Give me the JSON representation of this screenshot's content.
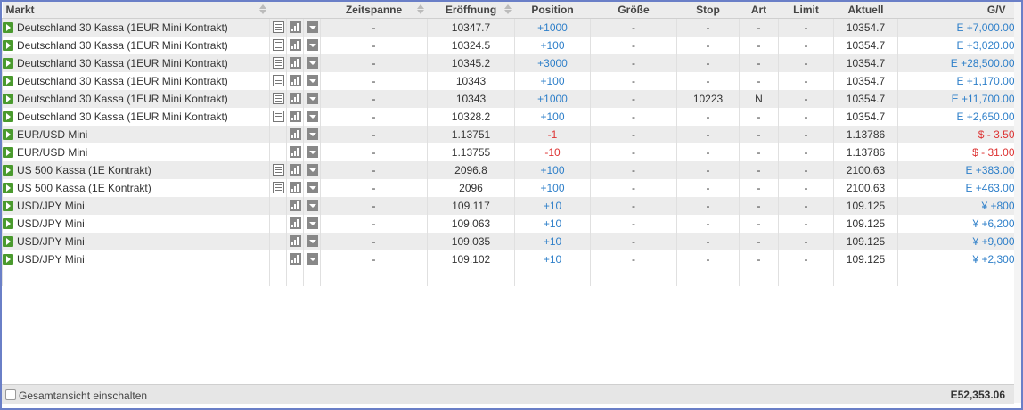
{
  "columns": {
    "markt": "Markt",
    "zeitspanne": "Zeitspanne",
    "eroeffnung": "Eröffnung",
    "position": "Position",
    "groesse": "Größe",
    "stop": "Stop",
    "art": "Art",
    "limit": "Limit",
    "aktuell": "Aktuell",
    "gv": "G/V"
  },
  "colors": {
    "positive": "#2e7fc9",
    "negative": "#dd3333",
    "play": "#4a9a2e"
  },
  "rows": [
    {
      "market": "Deutschland 30 Kassa (1EUR Mini Kontrakt)",
      "has_doc": true,
      "zeitspanne": "-",
      "eroeffnung": "10347.7",
      "position": "+1000",
      "pos_sign": "pos",
      "groesse": "-",
      "stop": "-",
      "art": "-",
      "limit": "-",
      "aktuell": "10354.7",
      "gv": "E +7,000.00",
      "gv_sign": "pos"
    },
    {
      "market": "Deutschland 30 Kassa (1EUR Mini Kontrakt)",
      "has_doc": true,
      "zeitspanne": "-",
      "eroeffnung": "10324.5",
      "position": "+100",
      "pos_sign": "pos",
      "groesse": "-",
      "stop": "-",
      "art": "-",
      "limit": "-",
      "aktuell": "10354.7",
      "gv": "E +3,020.00",
      "gv_sign": "pos"
    },
    {
      "market": "Deutschland 30 Kassa (1EUR Mini Kontrakt)",
      "has_doc": true,
      "zeitspanne": "-",
      "eroeffnung": "10345.2",
      "position": "+3000",
      "pos_sign": "pos",
      "groesse": "-",
      "stop": "-",
      "art": "-",
      "limit": "-",
      "aktuell": "10354.7",
      "gv": "E +28,500.00",
      "gv_sign": "pos"
    },
    {
      "market": "Deutschland 30 Kassa (1EUR Mini Kontrakt)",
      "has_doc": true,
      "zeitspanne": "-",
      "eroeffnung": "10343",
      "position": "+100",
      "pos_sign": "pos",
      "groesse": "-",
      "stop": "-",
      "art": "-",
      "limit": "-",
      "aktuell": "10354.7",
      "gv": "E +1,170.00",
      "gv_sign": "pos"
    },
    {
      "market": "Deutschland 30 Kassa (1EUR Mini Kontrakt)",
      "has_doc": true,
      "zeitspanne": "-",
      "eroeffnung": "10343",
      "position": "+1000",
      "pos_sign": "pos",
      "groesse": "-",
      "stop": "10223",
      "art": "N",
      "limit": "-",
      "aktuell": "10354.7",
      "gv": "E +11,700.00",
      "gv_sign": "pos"
    },
    {
      "market": "Deutschland 30 Kassa (1EUR Mini Kontrakt)",
      "has_doc": true,
      "zeitspanne": "-",
      "eroeffnung": "10328.2",
      "position": "+100",
      "pos_sign": "pos",
      "groesse": "-",
      "stop": "-",
      "art": "-",
      "limit": "-",
      "aktuell": "10354.7",
      "gv": "E +2,650.00",
      "gv_sign": "pos"
    },
    {
      "market": "EUR/USD Mini",
      "has_doc": false,
      "zeitspanne": "-",
      "eroeffnung": "1.13751",
      "position": "-1",
      "pos_sign": "neg",
      "groesse": "-",
      "stop": "-",
      "art": "-",
      "limit": "-",
      "aktuell": "1.13786",
      "gv": "$ - 3.50",
      "gv_sign": "neg"
    },
    {
      "market": "EUR/USD Mini",
      "has_doc": false,
      "zeitspanne": "-",
      "eroeffnung": "1.13755",
      "position": "-10",
      "pos_sign": "neg",
      "groesse": "-",
      "stop": "-",
      "art": "-",
      "limit": "-",
      "aktuell": "1.13786",
      "gv": "$ - 31.00",
      "gv_sign": "neg"
    },
    {
      "market": "US 500 Kassa (1E Kontrakt)",
      "has_doc": true,
      "zeitspanne": "-",
      "eroeffnung": "2096.8",
      "position": "+100",
      "pos_sign": "pos",
      "groesse": "-",
      "stop": "-",
      "art": "-",
      "limit": "-",
      "aktuell": "2100.63",
      "gv": "E +383.00",
      "gv_sign": "pos"
    },
    {
      "market": "US 500 Kassa (1E Kontrakt)",
      "has_doc": true,
      "zeitspanne": "-",
      "eroeffnung": "2096",
      "position": "+100",
      "pos_sign": "pos",
      "groesse": "-",
      "stop": "-",
      "art": "-",
      "limit": "-",
      "aktuell": "2100.63",
      "gv": "E +463.00",
      "gv_sign": "pos"
    },
    {
      "market": "USD/JPY Mini",
      "has_doc": false,
      "zeitspanne": "-",
      "eroeffnung": "109.117",
      "position": "+10",
      "pos_sign": "pos",
      "groesse": "-",
      "stop": "-",
      "art": "-",
      "limit": "-",
      "aktuell": "109.125",
      "gv": "¥ +800",
      "gv_sign": "pos"
    },
    {
      "market": "USD/JPY Mini",
      "has_doc": false,
      "zeitspanne": "-",
      "eroeffnung": "109.063",
      "position": "+10",
      "pos_sign": "pos",
      "groesse": "-",
      "stop": "-",
      "art": "-",
      "limit": "-",
      "aktuell": "109.125",
      "gv": "¥ +6,200",
      "gv_sign": "pos"
    },
    {
      "market": "USD/JPY Mini",
      "has_doc": false,
      "zeitspanne": "-",
      "eroeffnung": "109.035",
      "position": "+10",
      "pos_sign": "pos",
      "groesse": "-",
      "stop": "-",
      "art": "-",
      "limit": "-",
      "aktuell": "109.125",
      "gv": "¥ +9,000",
      "gv_sign": "pos"
    },
    {
      "market": "USD/JPY Mini",
      "has_doc": false,
      "zeitspanne": "-",
      "eroeffnung": "109.102",
      "position": "+10",
      "pos_sign": "pos",
      "groesse": "-",
      "stop": "-",
      "art": "-",
      "limit": "-",
      "aktuell": "109.125",
      "gv": "¥ +2,300",
      "gv_sign": "pos"
    }
  ],
  "footer": {
    "toggle_label": "Gesamtansicht einschalten",
    "total": "E52,353.06"
  },
  "icons": {
    "row_expand": "play-icon",
    "details": "document-icon",
    "chart": "bar-chart-icon",
    "menu": "dropdown-icon",
    "sort": "sort-arrows-icon"
  }
}
